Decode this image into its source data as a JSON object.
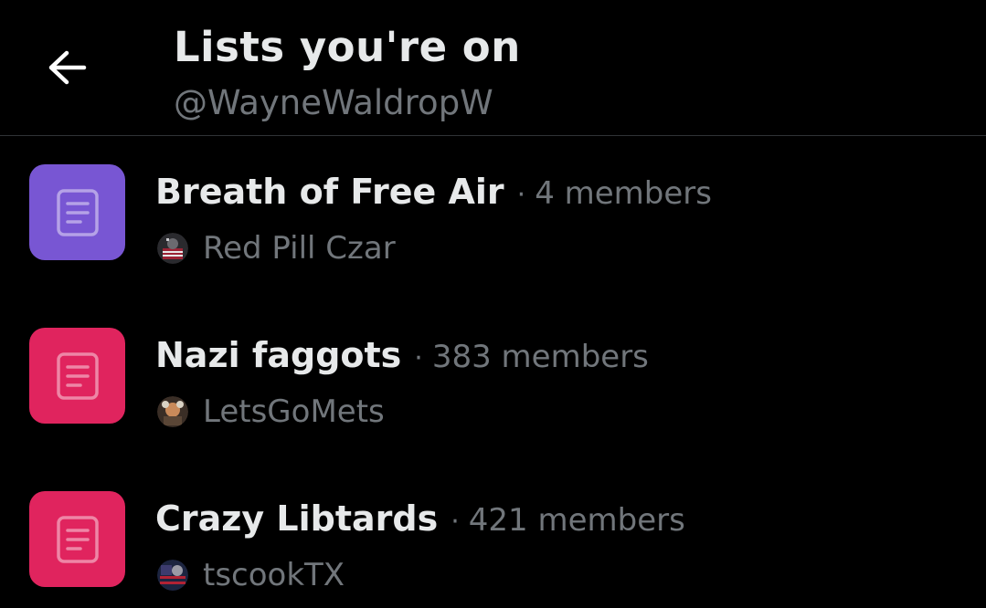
{
  "header": {
    "title": "Lists you're on",
    "subtitle": "@WayneWaldropW"
  },
  "lists": [
    {
      "name": "Breath of Free Air",
      "separator": "·",
      "members": "4 members",
      "owner": "Red Pill Czar",
      "icon_color": "#7856d3"
    },
    {
      "name": "Nazi faggots",
      "separator": "·",
      "members": "383 members",
      "owner": "LetsGoMets",
      "icon_color": "#e0245e"
    },
    {
      "name": "Crazy Libtards",
      "separator": "·",
      "members": "421 members",
      "owner": "tscookTX",
      "icon_color": "#e0245e"
    }
  ],
  "colors": {
    "background": "#000000",
    "primary_text": "#e7e9ea",
    "secondary_text": "#71767b",
    "divider": "#2f3336"
  }
}
